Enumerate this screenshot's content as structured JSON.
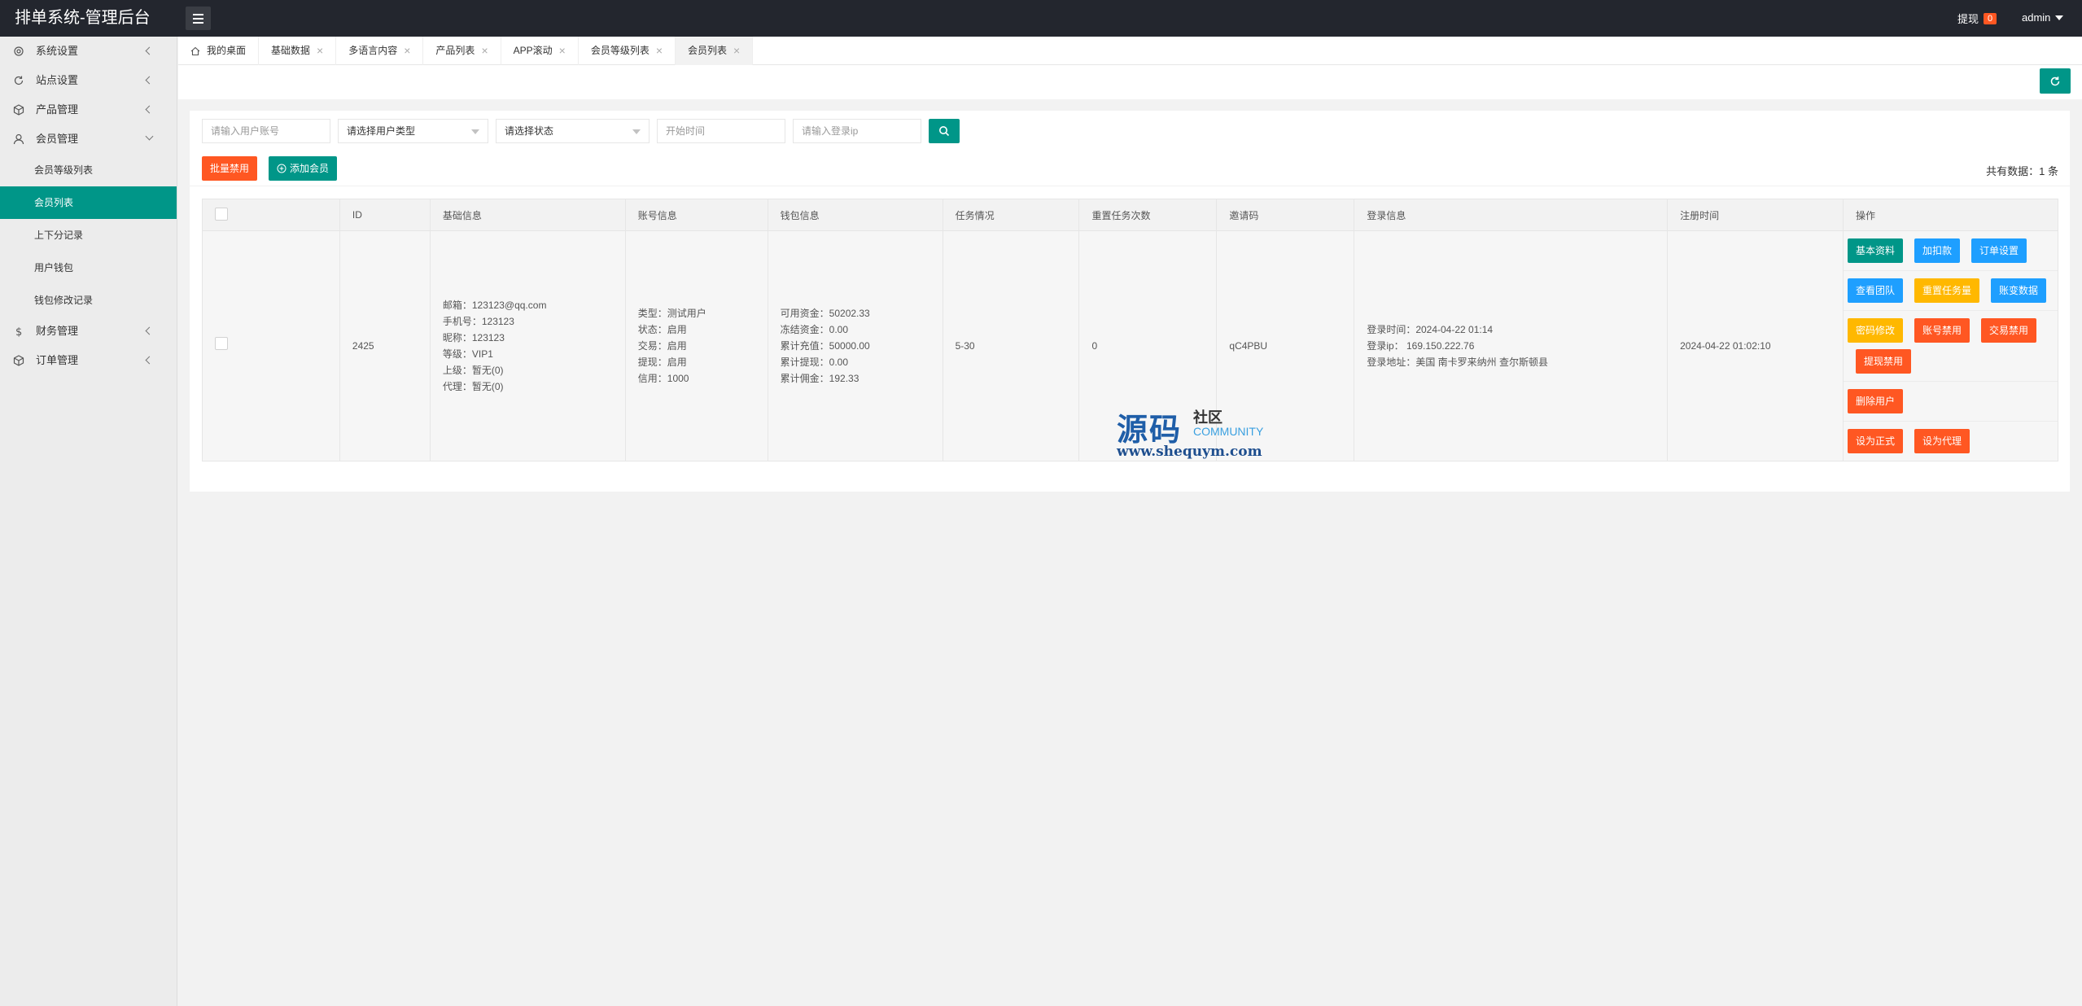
{
  "header": {
    "title": "排单系统-管理后台",
    "withdraw_label": "提现",
    "withdraw_count": "0",
    "user": "admin"
  },
  "sidebar": {
    "items": [
      {
        "label": "系统设置",
        "icon": "gear-icon"
      },
      {
        "label": "站点设置",
        "icon": "refresh-icon"
      },
      {
        "label": "产品管理",
        "icon": "box-icon"
      },
      {
        "label": "会员管理",
        "icon": "user-icon"
      },
      {
        "label": "财务管理",
        "icon": "dollar-icon"
      },
      {
        "label": "订单管理",
        "icon": "box-icon"
      }
    ],
    "sub_items": [
      "会员等级列表",
      "会员列表",
      "上下分记录",
      "用户钱包",
      "钱包修改记录"
    ]
  },
  "tabs": [
    {
      "label": "我的桌面"
    },
    {
      "label": "基础数据"
    },
    {
      "label": "多语言内容"
    },
    {
      "label": "产品列表"
    },
    {
      "label": "APP滚动"
    },
    {
      "label": "会员等级列表"
    },
    {
      "label": "会员列表"
    }
  ],
  "filters": {
    "account_placeholder": "请输入用户账号",
    "user_type": "请选择用户类型",
    "status": "请选择状态",
    "start_time_placeholder": "开始时间",
    "login_ip_placeholder": "请输入登录ip"
  },
  "actions": {
    "batch_disable": "批量禁用",
    "add_member": "添加会员",
    "total_text": "共有数据：1 条"
  },
  "table": {
    "headers": [
      "ID",
      "基础信息",
      "账号信息",
      "钱包信息",
      "任务情况",
      "重置任务次数",
      "邀请码",
      "登录信息",
      "注册时间",
      "操作"
    ],
    "row": {
      "id": "2425",
      "basic": [
        "邮箱：123123@qq.com",
        "手机号：123123",
        "昵称：123123",
        "等级：VIP1",
        "上级：暂无(0)",
        "代理：暂无(0)"
      ],
      "account": [
        "类型：测试用户",
        "状态：启用",
        "交易：启用",
        "提现：启用",
        "信用：1000"
      ],
      "wallet": [
        "可用资金：50202.33",
        "冻结资金：0.00",
        "累计充值：50000.00",
        "累计提现：0.00",
        "累计佣金：192.33"
      ],
      "task": "5-30",
      "reset_count": "0",
      "invite_code": "qC4PBU",
      "login": [
        "登录时间：2024-04-22 01:14",
        "登录ip： 169.150.222.76",
        "登录地址：美国 南卡罗来纳州 查尔斯顿县"
      ],
      "register_time": "2024-04-22 01:02:10",
      "ops": {
        "basic_info": "基本资料",
        "add_deduct": "加扣款",
        "order_settings": "订单设置",
        "view_team": "查看团队",
        "reset_task": "重置任务量",
        "account_data": "账变数据",
        "password_change": "密码修改",
        "account_disable": "账号禁用",
        "trade_disable": "交易禁用",
        "withdraw_disable": "提现禁用",
        "delete_user": "删除用户",
        "set_formal": "设为正式",
        "set_agent": "设为代理"
      }
    }
  },
  "watermark": {
    "big": "源码",
    "small": "社区",
    "community": "COMMUNITY",
    "url": "www.shequym.com"
  },
  "colors": {
    "header_bg": "#23262e",
    "primary": "#009688",
    "danger": "#ff5722",
    "info": "#1e9fff",
    "warn": "#ffb800"
  }
}
